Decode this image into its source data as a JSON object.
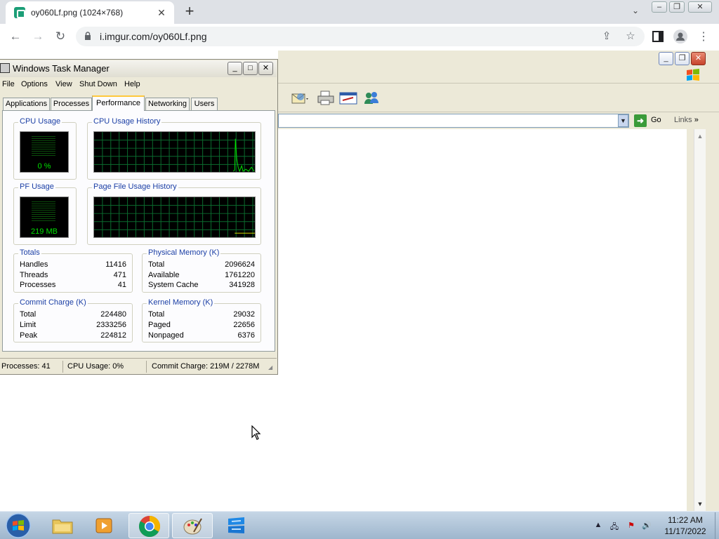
{
  "browser": {
    "tab_title": "oy060Lf.png (1024×768)",
    "tab_close": "✕",
    "new_tab": "+",
    "url": "i.imgur.com/oy060Lf.png",
    "back": "←",
    "forward": "→",
    "reload": "↻"
  },
  "background_window": {
    "go_label": "Go",
    "links_label": "Links"
  },
  "task_manager": {
    "title": "Windows Task Manager",
    "menu": [
      "File",
      "Options",
      "View",
      "Shut Down",
      "Help"
    ],
    "tabs": [
      "Applications",
      "Processes",
      "Performance",
      "Networking",
      "Users"
    ],
    "active_tab": "Performance",
    "cpu_usage": {
      "label": "CPU Usage",
      "value": "0 %"
    },
    "cpu_history": {
      "label": "CPU Usage History"
    },
    "pf_usage": {
      "label": "PF Usage",
      "value": "219 MB"
    },
    "pf_history": {
      "label": "Page File Usage History"
    },
    "totals": {
      "label": "Totals",
      "rows": [
        {
          "k": "Handles",
          "v": "11416"
        },
        {
          "k": "Threads",
          "v": "471"
        },
        {
          "k": "Processes",
          "v": "41"
        }
      ]
    },
    "physical_memory": {
      "label": "Physical Memory (K)",
      "rows": [
        {
          "k": "Total",
          "v": "2096624"
        },
        {
          "k": "Available",
          "v": "1761220"
        },
        {
          "k": "System Cache",
          "v": "341928"
        }
      ]
    },
    "commit_charge": {
      "label": "Commit Charge (K)",
      "rows": [
        {
          "k": "Total",
          "v": "224480"
        },
        {
          "k": "Limit",
          "v": "2333256"
        },
        {
          "k": "Peak",
          "v": "224812"
        }
      ]
    },
    "kernel_memory": {
      "label": "Kernel Memory (K)",
      "rows": [
        {
          "k": "Total",
          "v": "29032"
        },
        {
          "k": "Paged",
          "v": "22656"
        },
        {
          "k": "Nonpaged",
          "v": "6376"
        }
      ]
    },
    "status": {
      "processes": "Processes: 41",
      "cpu": "CPU Usage: 0%",
      "commit": "Commit Charge: 219M / 2278M"
    }
  },
  "taskbar": {
    "time": "11:22 AM",
    "date": "11/17/2022",
    "apps": [
      "windows-explorer",
      "media-player",
      "chrome",
      "paint",
      "remote-desktop"
    ]
  },
  "colors": {
    "graph_green": "#00e000",
    "group_label_blue": "#1b3fa5",
    "active_tab_accent": "#ffc83c"
  }
}
